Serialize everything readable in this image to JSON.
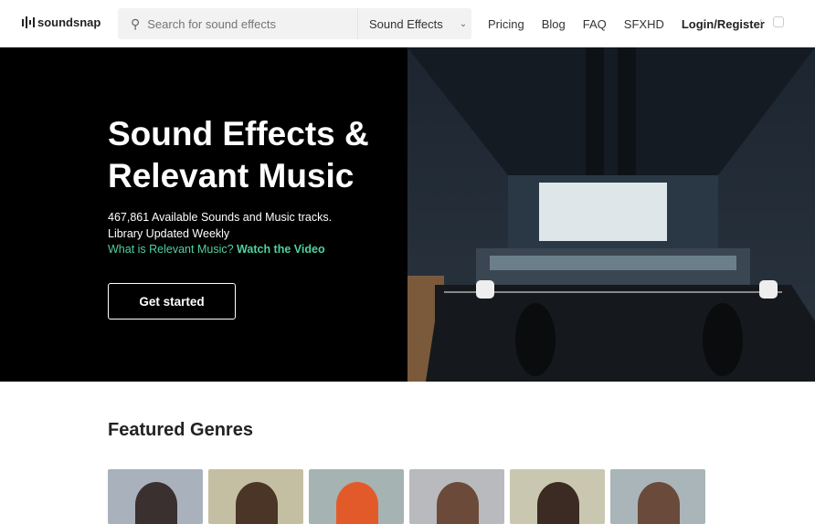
{
  "header": {
    "brand": "soundsnap",
    "search_placeholder": "Search for sound effects",
    "category": "Sound Effects",
    "nav": [
      "Pricing",
      "Blog",
      "FAQ",
      "SFXHD"
    ],
    "login": "Login/Register"
  },
  "hero": {
    "title": "Sound Effects & Relevant Music",
    "line1": "467,861 Available Sounds and Music tracks.",
    "line2": "Library Updated Weekly",
    "question": "What is Relevant Music?",
    "video_link": "Watch the Video",
    "cta": "Get started"
  },
  "featured": {
    "title": "Featured Genres",
    "cards": [
      {
        "bg": "#a9b2bc",
        "fg": "#3a3030"
      },
      {
        "bg": "#c4bfa2",
        "fg": "#4a3527"
      },
      {
        "bg": "#a5b3b3",
        "fg": "#e35a2a"
      },
      {
        "bg": "#b9babd",
        "fg": "#6b4a3a"
      },
      {
        "bg": "#c9c7b0",
        "fg": "#3b2b22"
      },
      {
        "bg": "#a9b5b8",
        "fg": "#6a4a3a"
      }
    ]
  },
  "colors": {
    "accent": "#4fd1a0"
  }
}
